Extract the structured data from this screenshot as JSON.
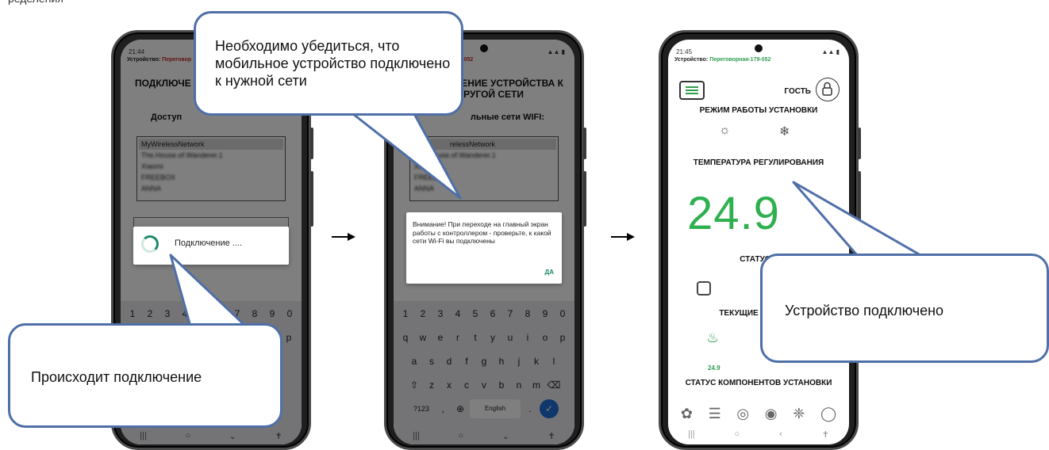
{
  "phone1": {
    "time": "21:44",
    "device_label": "Устройство:",
    "device_value": "Переговор",
    "title_line1": "ПОДКЛЮЧЕ",
    "title_line2": "ДР",
    "available": "Доступ",
    "wifi_items": [
      "MyWirelessNetwork",
      "The.House.of.Wanderer.1",
      "Xiaomi",
      "FREEBOX",
      "ANNA"
    ],
    "progress": "Подключение ...."
  },
  "phone2": {
    "title_line1": "НЕНИЕ УСТРОЙСТВА К",
    "title_line2": "ДРУГОЙ СЕТИ",
    "available": "льные сети WIFI:",
    "device_value": "ная-179-052",
    "wifi_items": [
      "relessNetwork",
      "The.House.of.Wanderer.1",
      "Xiaomi",
      "FREEBOX",
      "ANNA"
    ],
    "alert_text": "Внимание! При переходе на главный экран работы с контроллером - проверьте, к какой сети Wi-Fi вы подключены",
    "alert_ok": "ДА"
  },
  "keyboard": {
    "numbers": [
      "1",
      "2",
      "3",
      "4",
      "5",
      "6",
      "7",
      "8",
      "9",
      "0"
    ],
    "row1": [
      "q",
      "w",
      "e",
      "r",
      "t",
      "y",
      "u",
      "i",
      "o",
      "p"
    ],
    "row2": [
      "a",
      "s",
      "d",
      "f",
      "g",
      "h",
      "j",
      "k",
      "l"
    ],
    "row3": [
      "z",
      "x",
      "c",
      "v",
      "b",
      "n",
      "m"
    ],
    "sym": "?123",
    "space": "English"
  },
  "phone3": {
    "time": "21:45",
    "device_label": "Устройство:",
    "device_value": "Переговорная-179-052",
    "guest": "ГОСТЬ",
    "mode_heading": "РЕЖИМ РАБОТЫ УСТАНОВКИ",
    "temp_heading": "ТЕМПЕРАТУРА РЕГУЛИРОВАНИЯ",
    "temperature": "24.9",
    "status_heading": "СТАТУС УСТА",
    "current_heading": "ТЕКУЩИЕ П",
    "current_value": "24.9",
    "components_heading": "СТАТУС КОМПОНЕНТОВ УСТАНОВКИ"
  },
  "callouts": {
    "network_check": "Необходимо убедиться, что мобильное устройство подключено к нужной сети",
    "connecting": "Происходит подключение",
    "connected": "Устройство подключено"
  }
}
